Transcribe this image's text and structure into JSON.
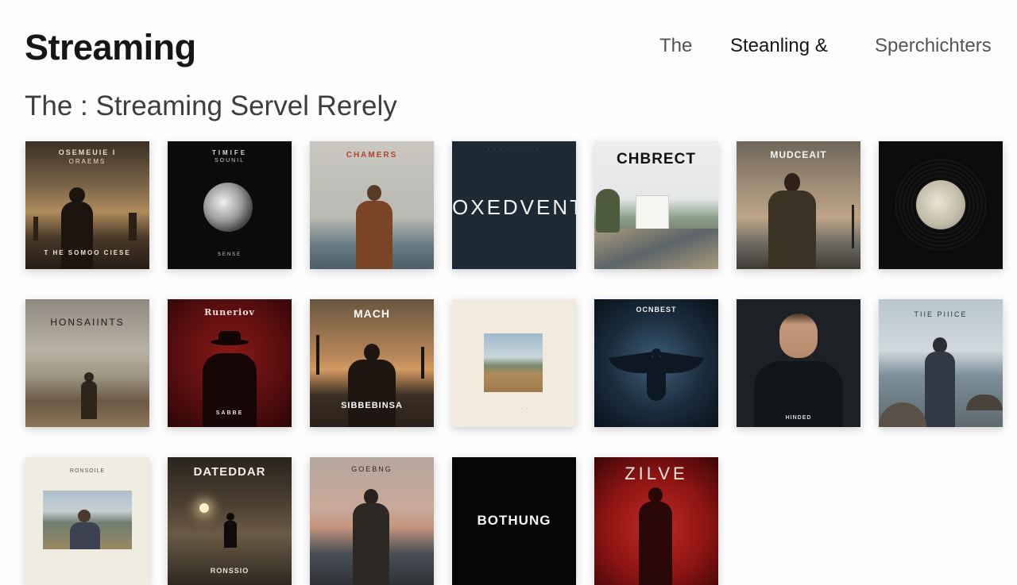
{
  "header": {
    "app_title": "Streaming",
    "nav": [
      "The",
      "Steanling &",
      "Sperchichters"
    ]
  },
  "section": {
    "title": "The : Streaming Servel Rerely"
  },
  "albums": [
    {
      "title": "OSEMEUIE I",
      "subtitle": "ORAEMS",
      "footer": "T HE SOMOO CIESE",
      "art": "dusk-silhouette"
    },
    {
      "title": "TIMIFE",
      "subtitle": "SOUNIL",
      "footer": "SENSE",
      "art": "speaker"
    },
    {
      "title": "CHAMERS",
      "subtitle": "",
      "footer": "",
      "art": "man-sea"
    },
    {
      "title": "OXEDVENT",
      "subtitle": "",
      "footer": "",
      "art": "dark-type"
    },
    {
      "title": "CHBRECT",
      "subtitle": "",
      "footer": "",
      "art": "church-road"
    },
    {
      "title": "MUDCEAIT",
      "subtitle": "",
      "footer": "",
      "art": "man-pier"
    },
    {
      "title": "",
      "subtitle": "",
      "footer": "",
      "art": "vinyl-moon"
    },
    {
      "title": "HONSAIINTS",
      "subtitle": "",
      "footer": "",
      "art": "field-figure"
    },
    {
      "title": "Runeriov",
      "subtitle": "",
      "footer": "SABBE",
      "art": "red-hat"
    },
    {
      "title": "MACH",
      "subtitle": "",
      "footer": "SIBBEBINSA",
      "art": "palms"
    },
    {
      "title": "",
      "subtitle": "",
      "footer": "",
      "art": "beige-photo"
    },
    {
      "title": "OCNBEST",
      "subtitle": "",
      "footer": "",
      "art": "angel"
    },
    {
      "title": "",
      "subtitle": "",
      "footer": "HINDED",
      "art": "portrait"
    },
    {
      "title": "TIIE PIIICE",
      "subtitle": "",
      "footer": "",
      "art": "rocks-sea"
    },
    {
      "title": "RONSOILE",
      "subtitle": "",
      "footer": "",
      "art": "cream-photo"
    },
    {
      "title": "DATEDDAR",
      "subtitle": "",
      "footer": "RONSSIO",
      "art": "street-night"
    },
    {
      "title": "GOEBNG",
      "subtitle": "",
      "footer": "",
      "art": "sunset-sea"
    },
    {
      "title": "BOTHUNG",
      "subtitle": "",
      "footer": "",
      "art": "black-type"
    },
    {
      "title": "ZILVE",
      "subtitle": "",
      "footer": "",
      "art": "red-figure"
    }
  ]
}
